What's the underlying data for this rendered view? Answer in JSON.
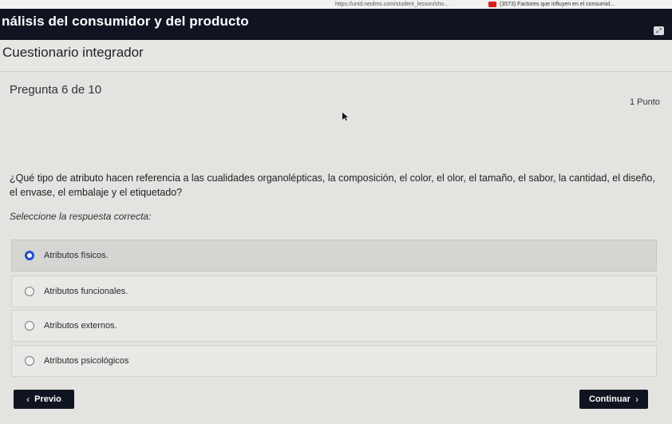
{
  "browser": {
    "url": "https://unid.neolms.com/student_lesson/sho...",
    "tab_title": "(3573) Factores que influyen en el consumid..."
  },
  "header": {
    "title": "nálisis del consumidor y del producto"
  },
  "section_title": "Cuestionario integrador",
  "question": {
    "number_label": "Pregunta 6 de 10",
    "points": "1 Punto",
    "text": "¿Qué tipo de atributo hacen referencia a las cualidades organolépticas, la composición, el color, el olor, el tamaño, el sabor, la cantidad, el diseño, el envase, el embalaje y el etiquetado?",
    "instruction": "Seleccione la respuesta correcta:",
    "options": [
      {
        "label": "Atributos físicos.",
        "selected": true
      },
      {
        "label": "Atributos funcionales.",
        "selected": false
      },
      {
        "label": "Atributos externos.",
        "selected": false
      },
      {
        "label": "Atributos psicológicos",
        "selected": false
      }
    ]
  },
  "nav": {
    "prev_label": "Previo",
    "next_label": "Continuar"
  },
  "colors": {
    "header_bg": "#0f1420",
    "accent": "#1d4ed8",
    "page_bg": "#e6e6e3"
  }
}
